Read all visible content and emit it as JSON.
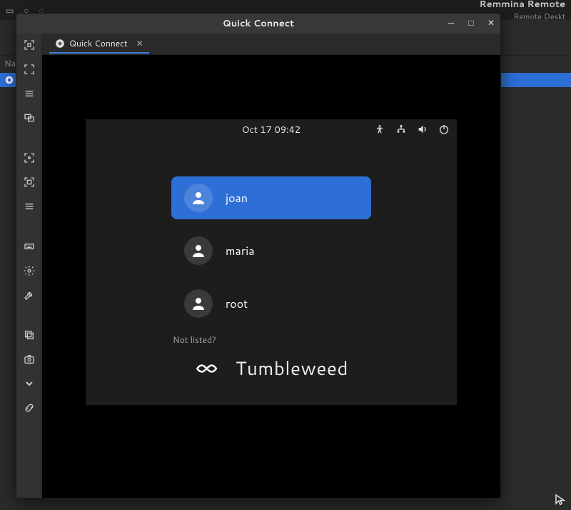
{
  "bg": {
    "app_title": "Remmina Remote",
    "app_subtitle": "Remote Deskt",
    "column_name": "Na"
  },
  "window": {
    "title": "Quick Connect"
  },
  "tab": {
    "label": "Quick Connect"
  },
  "remote": {
    "clock": "Oct 17  09:42",
    "users": [
      {
        "name": "joan",
        "selected": true
      },
      {
        "name": "maria",
        "selected": false
      },
      {
        "name": "root",
        "selected": false
      }
    ],
    "not_listed": "Not listed?",
    "distro": "Tumbleweed"
  },
  "colors": {
    "accent": "#2d6fd6"
  }
}
